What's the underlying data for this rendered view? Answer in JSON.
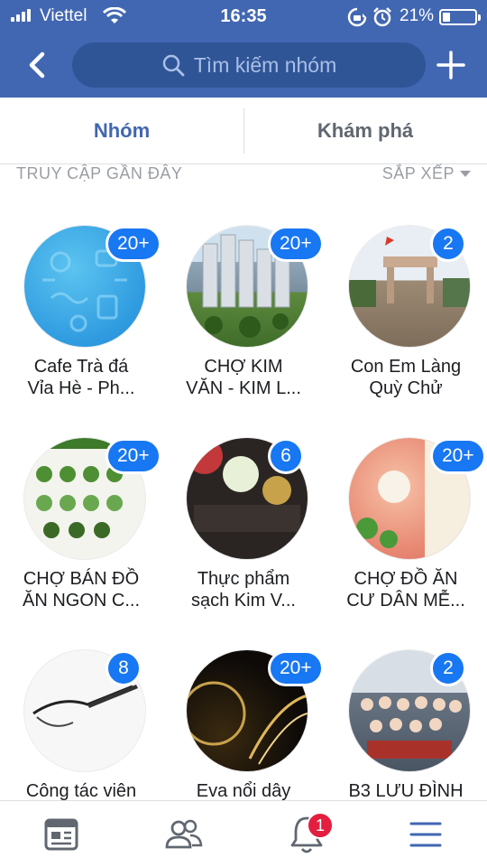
{
  "status_bar": {
    "carrier": "Viettel",
    "time": "16:35",
    "battery_percent": "21%",
    "icons": [
      "signal-icon",
      "wifi-icon",
      "rotation-lock-icon",
      "alarm-icon",
      "battery-icon"
    ]
  },
  "header": {
    "search_placeholder": "Tìm kiếm nhóm",
    "back_icon": "chevron-left-icon",
    "add_icon": "plus-icon"
  },
  "tabs": [
    {
      "label": "Nhóm",
      "active": true
    },
    {
      "label": "Khám phá",
      "active": false
    }
  ],
  "section": {
    "title": "TRUY CẬP GẦN ĐÂY",
    "sort_label": "SẮP XẾP"
  },
  "groups": [
    {
      "line1": "Cafe Trà đá",
      "line2": "Vỉa Hè - Ph...",
      "badge": "20+"
    },
    {
      "line1": "CHỢ KIM",
      "line2": "VĂN - KIM L...",
      "badge": "20+"
    },
    {
      "line1": "Con Em Làng",
      "line2": "Quỳ Chử",
      "badge": "2"
    },
    {
      "line1": "CHỢ BÁN ĐỒ",
      "line2": "ĂN NGON C...",
      "badge": "20+"
    },
    {
      "line1": "Thực phẩm",
      "line2": "sạch Kim V...",
      "badge": "6"
    },
    {
      "line1": "CHỢ ĐỒ ĂN",
      "line2": "CƯ DÂN MỄ...",
      "badge": "20+"
    },
    {
      "line1": "Công tác viên",
      "line2": "",
      "badge": "8"
    },
    {
      "line1": "Eva nổi dây",
      "line2": "",
      "badge": "20+"
    },
    {
      "line1": "B3 LƯU ĐÌNH",
      "line2": "",
      "badge": "2"
    }
  ],
  "bottom_nav": {
    "items": [
      "news-feed-icon",
      "friends-icon",
      "notifications-icon",
      "menu-icon"
    ],
    "notification_count": "1"
  },
  "colors": {
    "brand": "#4267b2",
    "badge": "#1877f2",
    "notif": "#e41e3f"
  }
}
